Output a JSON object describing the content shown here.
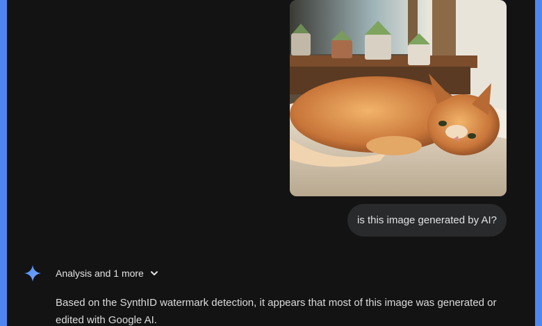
{
  "user_message": {
    "image_alt": "Orange tabby cat lying on a fluffy cushion by a sunny window with potted succulents",
    "text": "is this image generated by AI?"
  },
  "response": {
    "icon": "gemini-sparkle-icon",
    "tools_label": "Analysis and 1 more",
    "tools_icon": "chevron-down-icon",
    "text": "Based on the SynthID watermark detection, it appears that most of this image was generated or edited with Google AI."
  },
  "colors": {
    "frame_border": "#4e86f0",
    "background": "#131314",
    "bubble": "#282a2c",
    "accent": "#4c8df6"
  }
}
